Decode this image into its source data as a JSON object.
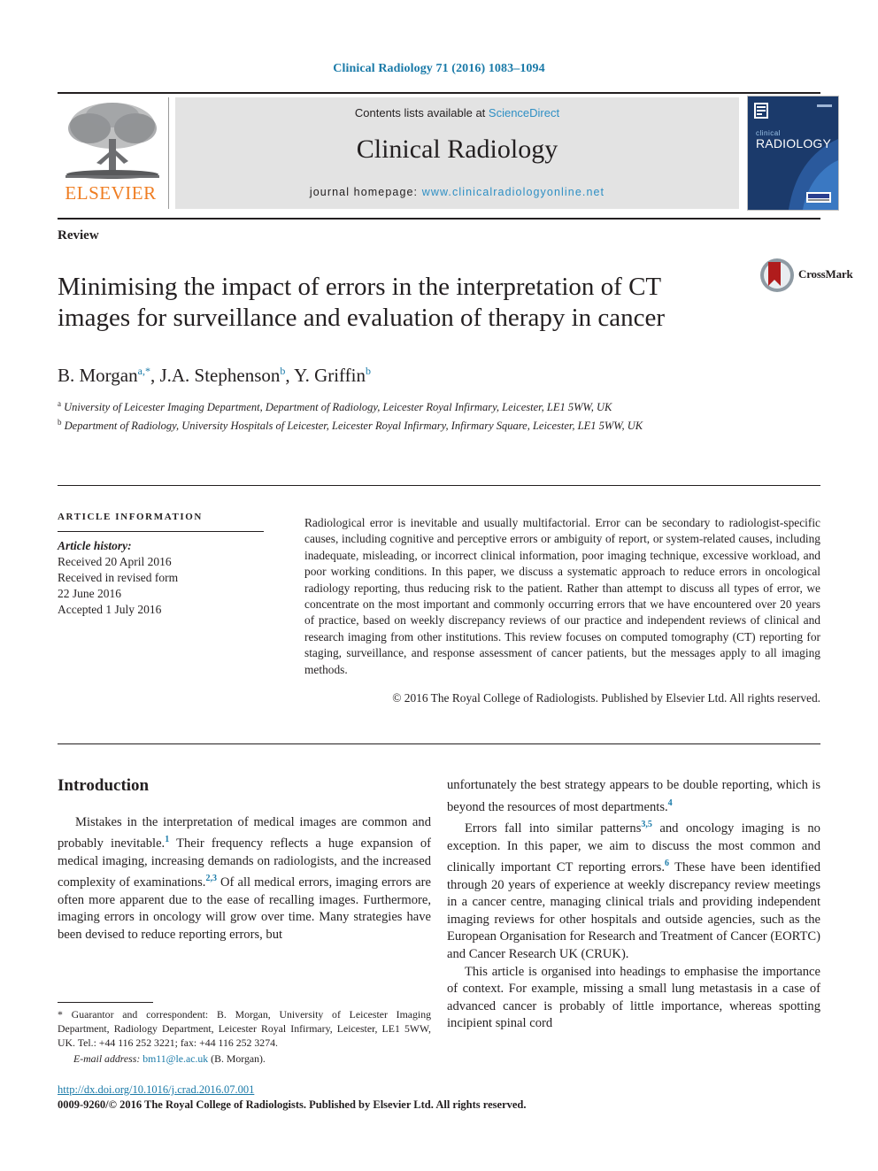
{
  "running_head": "Clinical Radiology 71 (2016) 1083–1094",
  "masthead": {
    "publisher_logo_label": "ELSEVIER",
    "contents_prefix": "Contents lists available at ",
    "contents_link": "ScienceDirect",
    "journal_name": "Clinical Radiology",
    "homepage_prefix": "journal homepage: ",
    "homepage_url": "www.clinicalradiologyonline.net",
    "cover_title_small": "clinical",
    "cover_title_large": "RADIOLOGY",
    "cover_badge": "RCR"
  },
  "article": {
    "type": "Review",
    "title": "Minimising the impact of errors in the interpretation of CT images for surveillance and evaluation of therapy in cancer",
    "crossmark_label": "CrossMark",
    "authors": [
      {
        "name": "B. Morgan",
        "marks": "a,*"
      },
      {
        "name": "J.A. Stephenson",
        "marks": "b"
      },
      {
        "name": "Y. Griffin",
        "marks": "b"
      }
    ],
    "affiliations": [
      {
        "mark": "a",
        "text": "University of Leicester Imaging Department, Department of Radiology, Leicester Royal Infirmary, Leicester, LE1 5WW, UK"
      },
      {
        "mark": "b",
        "text": "Department of Radiology, University Hospitals of Leicester, Leicester Royal Infirmary, Infirmary Square, Leicester, LE1 5WW, UK"
      }
    ]
  },
  "article_info": {
    "heading": "ARTICLE INFORMATION",
    "history_label": "Article history:",
    "history_lines": [
      "Received 20 April 2016",
      "Received in revised form",
      "22 June 2016",
      "Accepted 1 July 2016"
    ]
  },
  "abstract": {
    "body": "Radiological error is inevitable and usually multifactorial. Error can be secondary to radiologist-specific causes, including cognitive and perceptive errors or ambiguity of report, or system-related causes, including inadequate, misleading, or incorrect clinical information, poor imaging technique, excessive workload, and poor working conditions. In this paper, we discuss a systematic approach to reduce errors in oncological radiology reporting, thus reducing risk to the patient. Rather than attempt to discuss all types of error, we concentrate on the most important and commonly occurring errors that we have encountered over 20 years of practice, based on weekly discrepancy reviews of our practice and independent reviews of clinical and research imaging from other institutions. This review focuses on computed tomography (CT) reporting for staging, surveillance, and response assessment of cancer patients, but the messages apply to all imaging methods.",
    "copyright": "© 2016 The Royal College of Radiologists. Published by Elsevier Ltd. All rights reserved."
  },
  "body": {
    "section_heading": "Introduction",
    "left_paragraphs": [
      {
        "segments": [
          {
            "t": "Mistakes in the interpretation of medical images are common and probably inevitable."
          },
          {
            "ref": "1"
          },
          {
            "t": " Their frequency reflects a huge expansion of medical imaging, increasing demands on radiologists, and the increased complexity of examinations."
          },
          {
            "ref": "2,3"
          },
          {
            "t": " Of all medical errors, imaging errors are often more apparent due to the ease of recalling images. Furthermore, imaging errors in oncology will grow over time. Many strategies have been devised to reduce reporting errors, but"
          }
        ]
      }
    ],
    "right_paragraphs": [
      {
        "continued": true,
        "segments": [
          {
            "t": "unfortunately the best strategy appears to be double reporting, which is beyond the resources of most departments."
          },
          {
            "ref": "4"
          }
        ]
      },
      {
        "segments": [
          {
            "t": "Errors fall into similar patterns"
          },
          {
            "ref": "3,5"
          },
          {
            "t": " and oncology imaging is no exception. In this paper, we aim to discuss the most common and clinically important CT reporting errors."
          },
          {
            "ref": "6"
          },
          {
            "t": " These have been identified through 20 years of experience at weekly discrepancy review meetings in a cancer centre, managing clinical trials and providing independent imaging reviews for other hospitals and outside agencies, such as the European Organisation for Research and Treatment of Cancer (EORTC) and Cancer Research UK (CRUK)."
          }
        ]
      },
      {
        "segments": [
          {
            "t": "This article is organised into headings to emphasise the importance of context. For example, missing a small lung metastasis in a case of advanced cancer is probably of little importance, whereas spotting incipient spinal cord"
          }
        ]
      }
    ]
  },
  "footnote": {
    "correspondence": "* Guarantor and correspondent: B. Morgan, University of Leicester Imaging Department, Radiology Department, Leicester Royal Infirmary, Leicester, LE1 5WW, UK. Tel.: +44 116 252 3221; fax: +44 116 252 3274.",
    "email_label": "E-mail address:",
    "email": "bm11@le.ac.uk",
    "email_suffix": "(B. Morgan)."
  },
  "footer": {
    "doi": "http://dx.doi.org/10.1016/j.crad.2016.07.001",
    "copyright": "0009-9260/© 2016 The Royal College of Radiologists. Published by Elsevier Ltd. All rights reserved."
  },
  "colors": {
    "link_blue": "#1a7aa8",
    "sd_blue": "#2e8fc4",
    "elsevier_orange": "#ef7d22",
    "panel_grey": "#e3e3e3",
    "text": "#231f20",
    "cover_navy": "#1b3a6b"
  }
}
